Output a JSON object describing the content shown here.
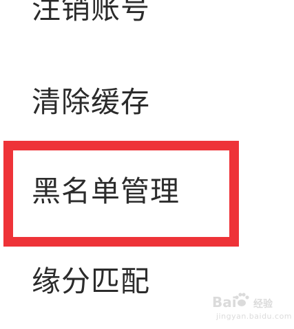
{
  "menu": {
    "items": [
      {
        "label": "注销账号"
      },
      {
        "label": "清除缓存"
      },
      {
        "label": "黑名单管理"
      },
      {
        "label": "缘分匹配"
      }
    ],
    "highlighted_index": 2
  },
  "watermark": {
    "brand": "Bai",
    "brand_suffix": "经验",
    "domain": "jingyan.baidu.com"
  },
  "colors": {
    "text": "#2b2b2b",
    "highlight": "#ee3338",
    "background": "#ffffff",
    "watermark": "#d8d8d8"
  }
}
